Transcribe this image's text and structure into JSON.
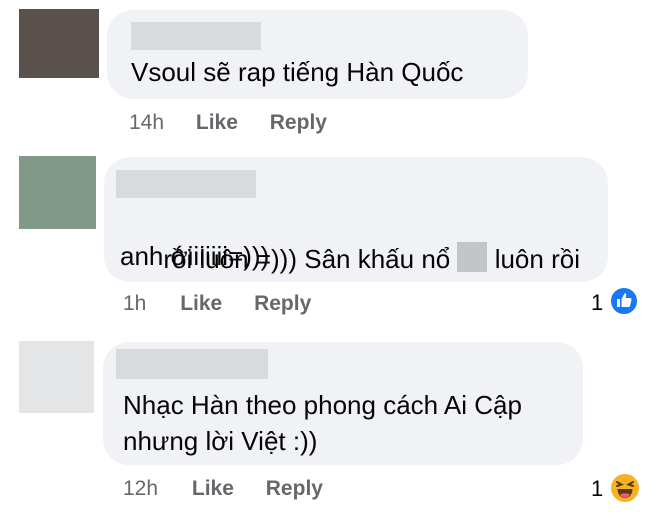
{
  "comments": [
    {
      "avatar_color": "#5b514c",
      "text_lines": [
        "Vsoul sẽ rap tiếng Hàn Quốc"
      ],
      "time": "14h",
      "like_label": "Like",
      "reply_label": "Reply"
    },
    {
      "avatar_color": "#7f9887",
      "text_line1_a": "rồi luôn =))) Sân khấu nổ ",
      "text_line1_b": " luôn rồi",
      "text_line2": "anh ớiiiiiii=)))",
      "time": "1h",
      "like_label": "Like",
      "reply_label": "Reply",
      "reaction_count": "1",
      "reaction_icon": "thumbs-up-icon"
    },
    {
      "avatar_color": "#e4e5e6",
      "text_line1": "Nhạc Hàn theo phong cách Ai Cập",
      "text_line2": "nhưng lời Việt :))",
      "time": "12h",
      "like_label": "Like",
      "reply_label": "Reply",
      "reaction_count": "1",
      "reaction_icon": "laughing-emoji-icon"
    }
  ],
  "colors": {
    "bubble": "#f0f2f5",
    "meta_text": "#65676b",
    "like_blue": "#1877f2",
    "haha_yellow": "#f7b125"
  }
}
